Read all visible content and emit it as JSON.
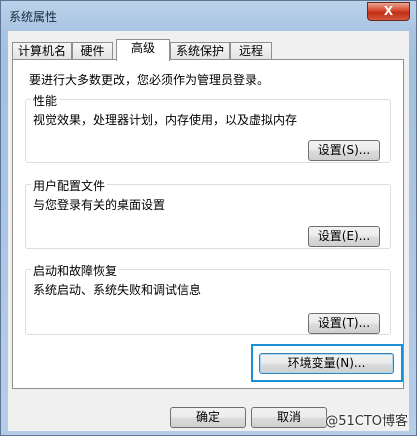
{
  "window": {
    "title": "系统属性",
    "close_glyph": "X"
  },
  "tabs": [
    {
      "label": "计算机名",
      "active": false
    },
    {
      "label": "硬件",
      "active": false
    },
    {
      "label": "高级",
      "active": true
    },
    {
      "label": "系统保护",
      "active": false
    },
    {
      "label": "远程",
      "active": false
    }
  ],
  "notice": "要进行大多数更改，您必须作为管理员登录。",
  "groups": {
    "performance": {
      "title": "性能",
      "description": "视觉效果，处理器计划，内存使用，以及虚拟内存",
      "button": "设置(S)..."
    },
    "user_profiles": {
      "title": "用户配置文件",
      "description": "与您登录有关的桌面设置",
      "button": "设置(E)..."
    },
    "startup_recovery": {
      "title": "启动和故障恢复",
      "description": "系统启动、系统失败和调试信息",
      "button": "设置(T)..."
    }
  },
  "env_button": "环境变量(N)...",
  "footer": {
    "ok": "确定",
    "cancel": "取消"
  },
  "watermark": "@51CTO博客"
}
